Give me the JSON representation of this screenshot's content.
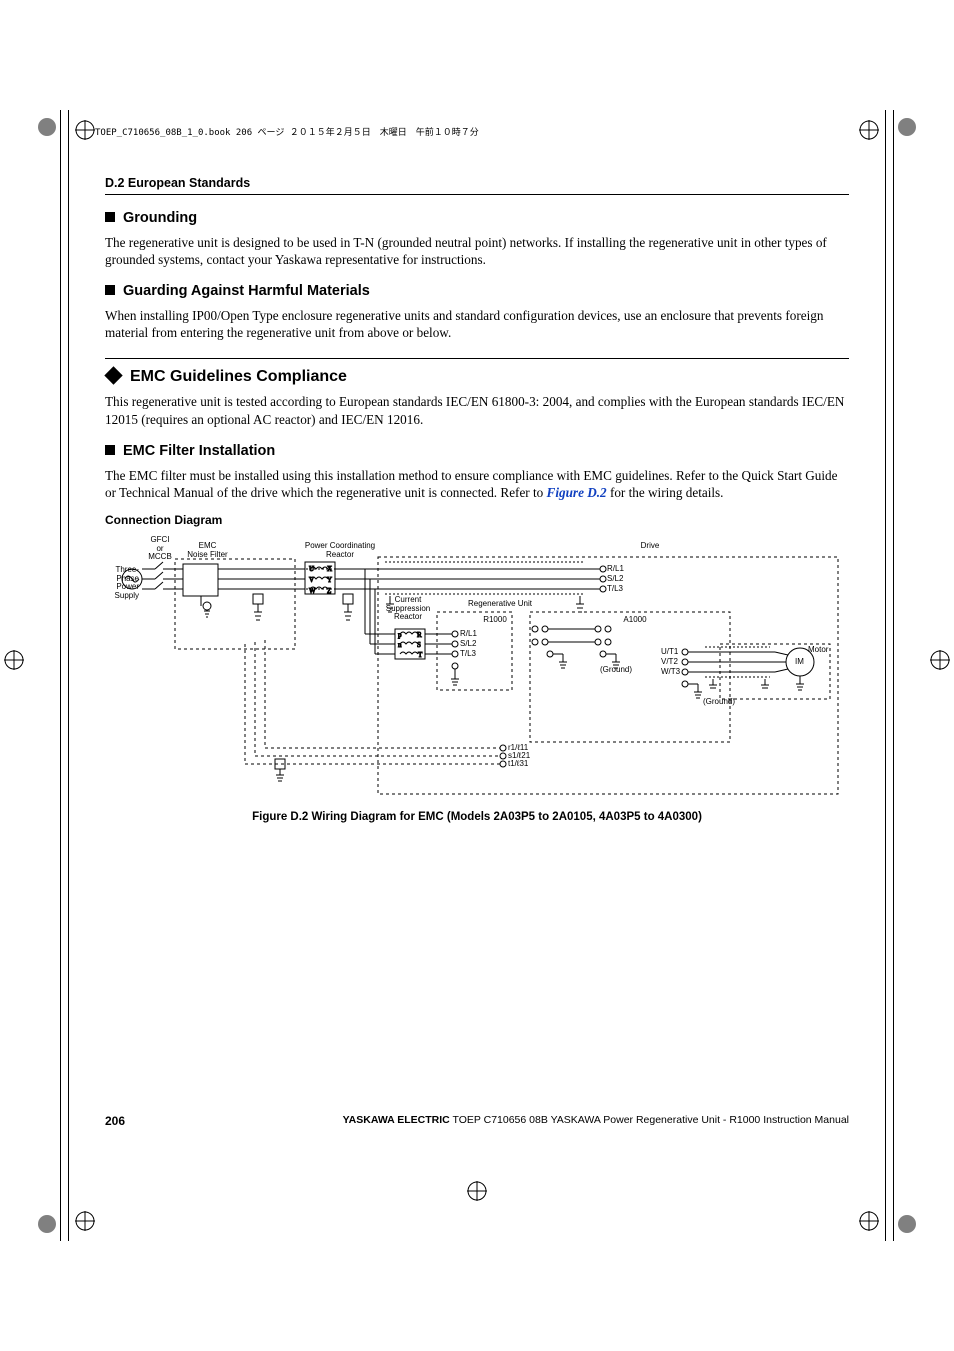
{
  "printHeader": "TOEP_C710656_08B_1_0.book  206 ページ  ２０１５年２月５日　木曜日　午前１０時７分",
  "sectionHeader": "D.2  European Standards",
  "h2_grounding": "Grounding",
  "p_grounding": "The regenerative unit is designed to be used in T-N (grounded neutral point) networks. If installing the regenerative unit in other types of grounded systems, contact your Yaskawa representative for instructions.",
  "h2_guarding": "Guarding Against Harmful Materials",
  "p_guarding": "When installing IP00/Open Type enclosure regenerative units and standard configuration devices, use an enclosure that prevents foreign material from entering the regenerative unit from above or below.",
  "h1_emc": "EMC Guidelines Compliance",
  "p_emc": "This regenerative unit is tested according to European standards IEC/EN 61800-3: 2004, and complies with the European standards IEC/EN 12015 (requires an optional AC reactor) and IEC/EN 12016.",
  "h2_filter": "EMC Filter Installation",
  "p_filter_a": "The EMC filter must be installed using this installation method to ensure compliance with EMC guidelines. Refer to the Quick Start Guide or Technical Manual of the drive which the regenerative unit is connected. Refer to ",
  "p_filter_link": "Figure D.2",
  "p_filter_b": " for the wiring details.",
  "subhead_conn": "Connection Diagram",
  "figCaption": "Figure D.2  Wiring Diagram for EMC (Models 2A03P5 to 2A0105, 4A03P5 to 4A0300)",
  "pageNum": "206",
  "footerBrand": "YASKAWA ELECTRIC",
  "footerText": " TOEP C710656 08B YASKAWA Power Regenerative Unit - R1000 Instruction Manual",
  "diagram": {
    "gfci": "GFCI\nor\nMCCB",
    "emcFilter": "EMC\nNoise Filter",
    "supply": "Three-\nPhase\nPower\nSupply",
    "pcr": "Power Coordinating\nReactor",
    "csr": "Current\nSuppression\nReactor",
    "regen": "Regenerative Unit",
    "r1000": "R1000",
    "drive": "Drive",
    "a1000": "A1000",
    "motor": "Motor",
    "im": "IM",
    "ground": "(Ground)",
    "ground2": "(Ground)",
    "rl1": "R/L1",
    "sl2": "S/L2",
    "tl3": "T/L3",
    "rl1b": "R/L1",
    "sl2b": "S/L2",
    "tl3b": "T/L3",
    "ut1": "U/T1",
    "vt2": "V/T2",
    "wt3": "W/T3",
    "U": "U",
    "V": "V",
    "W": "W",
    "X": "X",
    "Y": "Y",
    "Z": "Z",
    "p": "p",
    "n": "n",
    "R": "R",
    "S": "S",
    "T": "T",
    "plus": "+",
    "minus": "-",
    "r1l11": "r1/ℓ11",
    "s1l21": "s1/ℓ21",
    "t1l31": "t1/ℓ31"
  }
}
